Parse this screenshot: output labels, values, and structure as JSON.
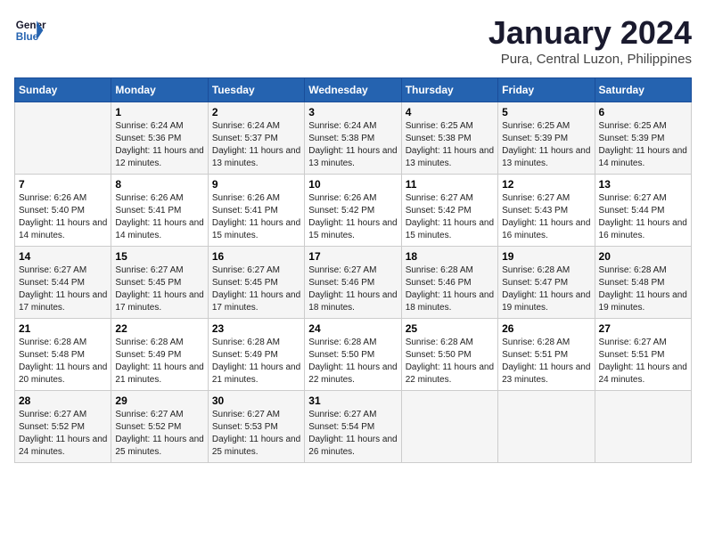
{
  "logo": {
    "line1": "General",
    "line2": "Blue"
  },
  "title": "January 2024",
  "subtitle": "Pura, Central Luzon, Philippines",
  "days_of_week": [
    "Sunday",
    "Monday",
    "Tuesday",
    "Wednesday",
    "Thursday",
    "Friday",
    "Saturday"
  ],
  "weeks": [
    [
      {
        "num": "",
        "sunrise": "",
        "sunset": "",
        "daylight": ""
      },
      {
        "num": "1",
        "sunrise": "Sunrise: 6:24 AM",
        "sunset": "Sunset: 5:36 PM",
        "daylight": "Daylight: 11 hours and 12 minutes."
      },
      {
        "num": "2",
        "sunrise": "Sunrise: 6:24 AM",
        "sunset": "Sunset: 5:37 PM",
        "daylight": "Daylight: 11 hours and 13 minutes."
      },
      {
        "num": "3",
        "sunrise": "Sunrise: 6:24 AM",
        "sunset": "Sunset: 5:38 PM",
        "daylight": "Daylight: 11 hours and 13 minutes."
      },
      {
        "num": "4",
        "sunrise": "Sunrise: 6:25 AM",
        "sunset": "Sunset: 5:38 PM",
        "daylight": "Daylight: 11 hours and 13 minutes."
      },
      {
        "num": "5",
        "sunrise": "Sunrise: 6:25 AM",
        "sunset": "Sunset: 5:39 PM",
        "daylight": "Daylight: 11 hours and 13 minutes."
      },
      {
        "num": "6",
        "sunrise": "Sunrise: 6:25 AM",
        "sunset": "Sunset: 5:39 PM",
        "daylight": "Daylight: 11 hours and 14 minutes."
      }
    ],
    [
      {
        "num": "7",
        "sunrise": "Sunrise: 6:26 AM",
        "sunset": "Sunset: 5:40 PM",
        "daylight": "Daylight: 11 hours and 14 minutes."
      },
      {
        "num": "8",
        "sunrise": "Sunrise: 6:26 AM",
        "sunset": "Sunset: 5:41 PM",
        "daylight": "Daylight: 11 hours and 14 minutes."
      },
      {
        "num": "9",
        "sunrise": "Sunrise: 6:26 AM",
        "sunset": "Sunset: 5:41 PM",
        "daylight": "Daylight: 11 hours and 15 minutes."
      },
      {
        "num": "10",
        "sunrise": "Sunrise: 6:26 AM",
        "sunset": "Sunset: 5:42 PM",
        "daylight": "Daylight: 11 hours and 15 minutes."
      },
      {
        "num": "11",
        "sunrise": "Sunrise: 6:27 AM",
        "sunset": "Sunset: 5:42 PM",
        "daylight": "Daylight: 11 hours and 15 minutes."
      },
      {
        "num": "12",
        "sunrise": "Sunrise: 6:27 AM",
        "sunset": "Sunset: 5:43 PM",
        "daylight": "Daylight: 11 hours and 16 minutes."
      },
      {
        "num": "13",
        "sunrise": "Sunrise: 6:27 AM",
        "sunset": "Sunset: 5:44 PM",
        "daylight": "Daylight: 11 hours and 16 minutes."
      }
    ],
    [
      {
        "num": "14",
        "sunrise": "Sunrise: 6:27 AM",
        "sunset": "Sunset: 5:44 PM",
        "daylight": "Daylight: 11 hours and 17 minutes."
      },
      {
        "num": "15",
        "sunrise": "Sunrise: 6:27 AM",
        "sunset": "Sunset: 5:45 PM",
        "daylight": "Daylight: 11 hours and 17 minutes."
      },
      {
        "num": "16",
        "sunrise": "Sunrise: 6:27 AM",
        "sunset": "Sunset: 5:45 PM",
        "daylight": "Daylight: 11 hours and 17 minutes."
      },
      {
        "num": "17",
        "sunrise": "Sunrise: 6:27 AM",
        "sunset": "Sunset: 5:46 PM",
        "daylight": "Daylight: 11 hours and 18 minutes."
      },
      {
        "num": "18",
        "sunrise": "Sunrise: 6:28 AM",
        "sunset": "Sunset: 5:46 PM",
        "daylight": "Daylight: 11 hours and 18 minutes."
      },
      {
        "num": "19",
        "sunrise": "Sunrise: 6:28 AM",
        "sunset": "Sunset: 5:47 PM",
        "daylight": "Daylight: 11 hours and 19 minutes."
      },
      {
        "num": "20",
        "sunrise": "Sunrise: 6:28 AM",
        "sunset": "Sunset: 5:48 PM",
        "daylight": "Daylight: 11 hours and 19 minutes."
      }
    ],
    [
      {
        "num": "21",
        "sunrise": "Sunrise: 6:28 AM",
        "sunset": "Sunset: 5:48 PM",
        "daylight": "Daylight: 11 hours and 20 minutes."
      },
      {
        "num": "22",
        "sunrise": "Sunrise: 6:28 AM",
        "sunset": "Sunset: 5:49 PM",
        "daylight": "Daylight: 11 hours and 21 minutes."
      },
      {
        "num": "23",
        "sunrise": "Sunrise: 6:28 AM",
        "sunset": "Sunset: 5:49 PM",
        "daylight": "Daylight: 11 hours and 21 minutes."
      },
      {
        "num": "24",
        "sunrise": "Sunrise: 6:28 AM",
        "sunset": "Sunset: 5:50 PM",
        "daylight": "Daylight: 11 hours and 22 minutes."
      },
      {
        "num": "25",
        "sunrise": "Sunrise: 6:28 AM",
        "sunset": "Sunset: 5:50 PM",
        "daylight": "Daylight: 11 hours and 22 minutes."
      },
      {
        "num": "26",
        "sunrise": "Sunrise: 6:28 AM",
        "sunset": "Sunset: 5:51 PM",
        "daylight": "Daylight: 11 hours and 23 minutes."
      },
      {
        "num": "27",
        "sunrise": "Sunrise: 6:27 AM",
        "sunset": "Sunset: 5:51 PM",
        "daylight": "Daylight: 11 hours and 24 minutes."
      }
    ],
    [
      {
        "num": "28",
        "sunrise": "Sunrise: 6:27 AM",
        "sunset": "Sunset: 5:52 PM",
        "daylight": "Daylight: 11 hours and 24 minutes."
      },
      {
        "num": "29",
        "sunrise": "Sunrise: 6:27 AM",
        "sunset": "Sunset: 5:52 PM",
        "daylight": "Daylight: 11 hours and 25 minutes."
      },
      {
        "num": "30",
        "sunrise": "Sunrise: 6:27 AM",
        "sunset": "Sunset: 5:53 PM",
        "daylight": "Daylight: 11 hours and 25 minutes."
      },
      {
        "num": "31",
        "sunrise": "Sunrise: 6:27 AM",
        "sunset": "Sunset: 5:54 PM",
        "daylight": "Daylight: 11 hours and 26 minutes."
      },
      {
        "num": "",
        "sunrise": "",
        "sunset": "",
        "daylight": ""
      },
      {
        "num": "",
        "sunrise": "",
        "sunset": "",
        "daylight": ""
      },
      {
        "num": "",
        "sunrise": "",
        "sunset": "",
        "daylight": ""
      }
    ]
  ]
}
